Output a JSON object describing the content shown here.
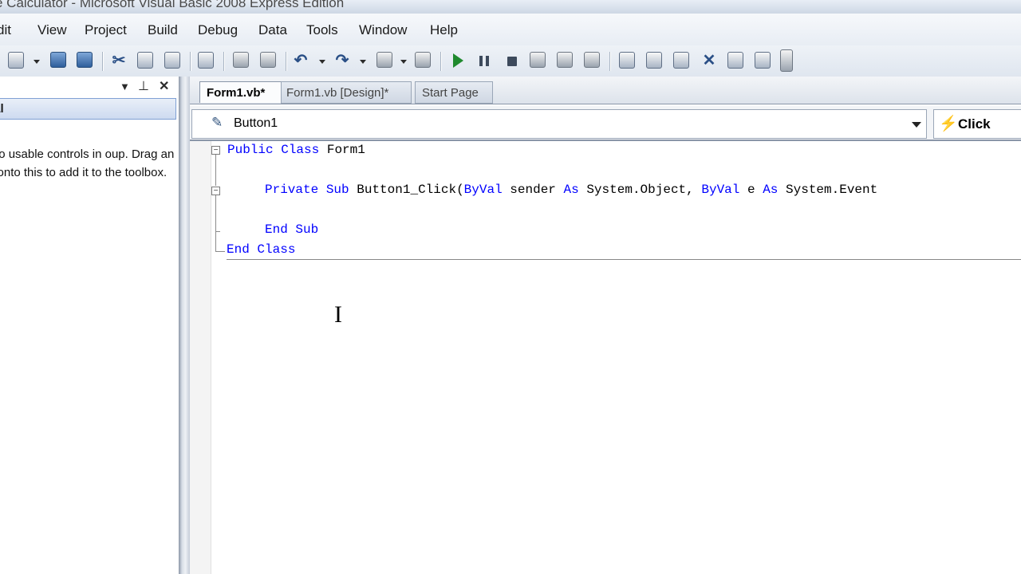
{
  "window": {
    "title": "e Calculator - Microsoft Visual Basic 2008 Express Edition"
  },
  "menu": [
    "dit",
    "View",
    "Project",
    "Build",
    "Debug",
    "Data",
    "Tools",
    "Window",
    "Help"
  ],
  "toolbox": {
    "group": "eral",
    "message": "are no usable controls in oup. Drag an item onto this to add it to the toolbox."
  },
  "tabs": {
    "active": "Form1.vb*",
    "design": "Form1.vb [Design]*",
    "start": "Start Page"
  },
  "nav": {
    "class": "Button1",
    "method": "Click"
  },
  "code": {
    "line1": {
      "kw1": "Public",
      "kw2": "Class",
      "name": "Form1"
    },
    "line2": {
      "kw1": "Private",
      "kw2": "Sub",
      "sig": "Button1_Click(",
      "kw3": "ByVal",
      "p1": "sender",
      "kw4": "As",
      "t1": "System.Object,",
      "kw5": "ByVal",
      "p2": "e",
      "kw6": "As",
      "t2": "System.Event"
    },
    "line3": {
      "kw1": "End",
      "kw2": "Sub"
    },
    "line4": {
      "kw1": "End",
      "kw2": "Class"
    }
  },
  "icons": [
    "new-project-icon",
    "save-icon",
    "save-all-icon",
    "cut-icon",
    "copy-icon",
    "paste-icon",
    "find-icon",
    "indent-icon",
    "outdent-icon",
    "undo-icon",
    "redo-icon",
    "navigate-backward-icon",
    "navigate-forward-icon",
    "start-debugging-icon",
    "pause-icon",
    "stop-icon",
    "step-into-icon",
    "step-over-icon",
    "step-out-icon",
    "solution-explorer-icon",
    "properties-icon",
    "object-browser-icon",
    "toolbox-icon",
    "error-list-icon",
    "start-page-icon"
  ]
}
